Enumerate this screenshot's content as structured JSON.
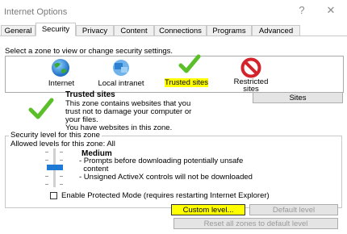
{
  "window": {
    "title": "Internet Options",
    "help": "?",
    "close": "✕"
  },
  "tabs": [
    {
      "label": "General"
    },
    {
      "label": "Security"
    },
    {
      "label": "Privacy"
    },
    {
      "label": "Content"
    },
    {
      "label": "Connections"
    },
    {
      "label": "Programs"
    },
    {
      "label": "Advanced"
    }
  ],
  "zones": {
    "prompt": "Select a zone to view or change security settings.",
    "items": [
      {
        "label": "Internet",
        "icon": "globe-icon"
      },
      {
        "label": "Local intranet",
        "icon": "network-icon"
      },
      {
        "label": "Trusted sites",
        "icon": "checkmark-icon"
      },
      {
        "label": "Restricted sites",
        "line1": "Restricted",
        "line2": "sites",
        "icon": "no-entry-icon"
      }
    ]
  },
  "selected_zone": {
    "title": "Trusted sites",
    "desc_lines": [
      "This zone contains websites that you",
      "trust not to damage your computer or",
      "your files.",
      "You have websites in this zone."
    ],
    "sites_button": "Sites"
  },
  "security": {
    "legend": "Security level for this zone",
    "allowed": "Allowed levels for this zone: All",
    "level": "Medium",
    "bullets": [
      "- Prompts before downloading potentially unsafe",
      "  content",
      "- Unsigned ActiveX controls will not be downloaded"
    ],
    "protected_mode": "Enable Protected Mode (requires restarting Internet Explorer)",
    "custom_button": "Custom level...",
    "default_button": "Default level",
    "reset_button": "Reset all zones to default level"
  },
  "colors": {
    "highlight": "#ffff00",
    "accent": "#1f7ad6",
    "check": "#5bbf2a",
    "no_entry": "#d4232a"
  }
}
